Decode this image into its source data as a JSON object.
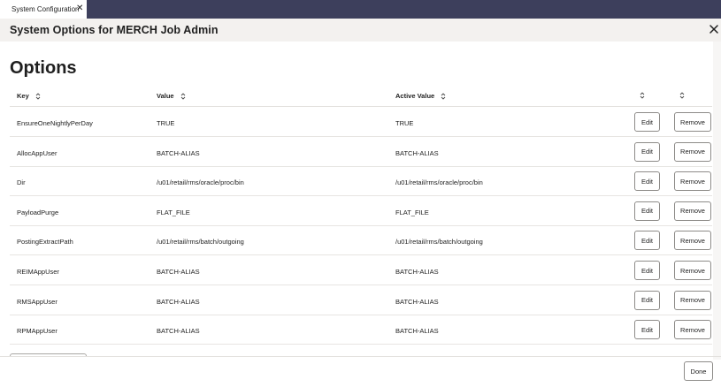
{
  "tab": {
    "label": "System Configuration",
    "close_glyph": "✕"
  },
  "dialog": {
    "title": "System Options for MERCH Job Admin",
    "close_icon": "close-icon"
  },
  "section": {
    "title": "Options"
  },
  "table": {
    "columns": {
      "key": "Key",
      "value": "Value",
      "active_value": "Active Value"
    },
    "edit_label": "Edit",
    "remove_label": "Remove",
    "rows": [
      {
        "key": "EnsureOneNightlyPerDay",
        "value": "TRUE",
        "active_value": "TRUE"
      },
      {
        "key": "AllocAppUser",
        "value": "BATCH-ALIAS",
        "active_value": "BATCH-ALIAS"
      },
      {
        "key": "Dir",
        "value": "/u01/retail/rms/oracle/proc/bin",
        "active_value": "/u01/retail/rms/oracle/proc/bin"
      },
      {
        "key": "PayloadPurge",
        "value": "FLAT_FILE",
        "active_value": "FLAT_FILE"
      },
      {
        "key": "PostingExtractPath",
        "value": "/u01/retail/rms/batch/outgoing",
        "active_value": "/u01/retail/rms/batch/outgoing"
      },
      {
        "key": "REIMAppUser",
        "value": "BATCH-ALIAS",
        "active_value": "BATCH-ALIAS"
      },
      {
        "key": "RMSAppUser",
        "value": "BATCH-ALIAS",
        "active_value": "BATCH-ALIAS"
      },
      {
        "key": "RPMAppUser",
        "value": "BATCH-ALIAS",
        "active_value": "BATCH-ALIAS"
      }
    ]
  },
  "footer": {
    "done_label": "Done"
  },
  "colors": {
    "tabbar": "#3d3f5c",
    "header_bg": "#f3f1ef",
    "border": "#e3e1de"
  }
}
